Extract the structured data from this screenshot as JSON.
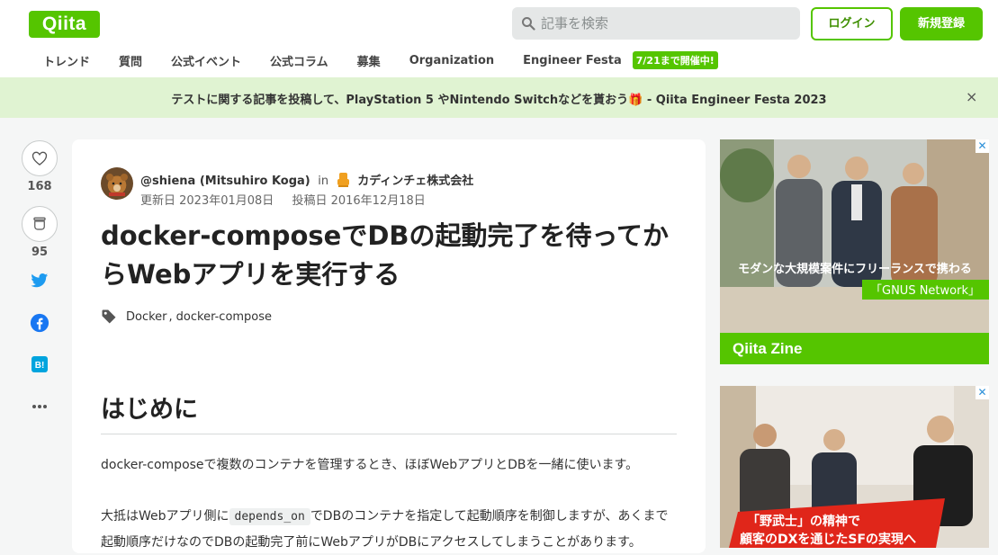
{
  "header": {
    "logo": "Qiita",
    "search_placeholder": "記事を検索",
    "login_label": "ログイン",
    "signup_label": "新規登録"
  },
  "nav": {
    "items": [
      "トレンド",
      "質問",
      "公式イベント",
      "公式コラム",
      "募集",
      "Organization",
      "Engineer Festa"
    ],
    "badge": "7/21まで開催中!"
  },
  "banner": {
    "text": "テストに関する記事を投稿して、PlayStation 5 やNintendo Switchなどを貰おう🎁 - Qiita Engineer Festa 2023",
    "close": "×"
  },
  "actions": {
    "likes": "168",
    "stocks": "95"
  },
  "article": {
    "author": "@shiena (Mitsuhiro Koga)",
    "in": "in",
    "org": "カディンチェ株式会社",
    "updated": "更新日 2023年01月08日",
    "posted": "投稿日 2016年12月18日",
    "title": "docker-composeでDBの起動完了を待ってからWebアプリを実行する",
    "tags": [
      "Docker",
      "docker-compose"
    ],
    "heading": "はじめに",
    "p1": "docker-composeで複数のコンテナを管理するとき、ほぼWebアプリとDBを一緒に使います。",
    "p2_before": "大抵はWebアプリ側に",
    "p2_code": "depends_on",
    "p2_after": "でDBのコンテナを指定して起動順序を制御しますが、あくまで起動順序だけなのでDBの起動完了前にWebアプリがDBにアクセスしてしまうことがあります。"
  },
  "ads": {
    "ad1_caption": "モダンな大規模案件にフリーランスで携わる",
    "ad1_caption2": "「GNUS Network」",
    "ad1_brand": "Qiita Zine",
    "ad2_caption": "「野武士」の精神で",
    "ad2_caption2": "顧客のDXを通じたSFの実現へ"
  },
  "colors": {
    "brand": "#55c500",
    "banner_bg": "#e0f3d2"
  }
}
